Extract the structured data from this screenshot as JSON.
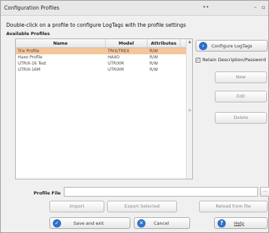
{
  "window": {
    "title": "Configuration Profiles",
    "minimize_glyph": "–",
    "maximize_glyph": "▫"
  },
  "instruction": "Double-click on a profile to configure LogTags with the profile settings",
  "section_label": "Available Profiles",
  "grid": {
    "columns": [
      "Name",
      "Model",
      "Attributes"
    ],
    "rows": [
      {
        "name": "Trix Profile",
        "model": "TRIX/TREX",
        "attributes": "R/W",
        "selected": true
      },
      {
        "name": "Haxo Profile",
        "model": "HAXO",
        "attributes": "R/W",
        "selected": false
      },
      {
        "name": "UTRIX-16 Test",
        "model": "UTRIXM",
        "attributes": "R/W",
        "selected": false
      },
      {
        "name": "UTRIX-16M",
        "model": "UTRIXM",
        "attributes": "R/W",
        "selected": false
      }
    ]
  },
  "side": {
    "configure_label": "Configure LogTags",
    "retain_label": "Retain Description/Password",
    "retain_checked": true,
    "new_label": "New",
    "edit_label": "Edit",
    "delete_label": "Delete"
  },
  "profile_file": {
    "label": "Profile File",
    "value": "",
    "browse_glyph": "..."
  },
  "bottom": {
    "import_label": "Import",
    "export_label": "Export Selected",
    "reload_label": "Reload from file",
    "save_label": "Save and exit",
    "cancel_label": "Cancel",
    "help_label": "Help"
  },
  "colors": {
    "accent": "#2e6fcc",
    "selection": "#f7c59a"
  }
}
